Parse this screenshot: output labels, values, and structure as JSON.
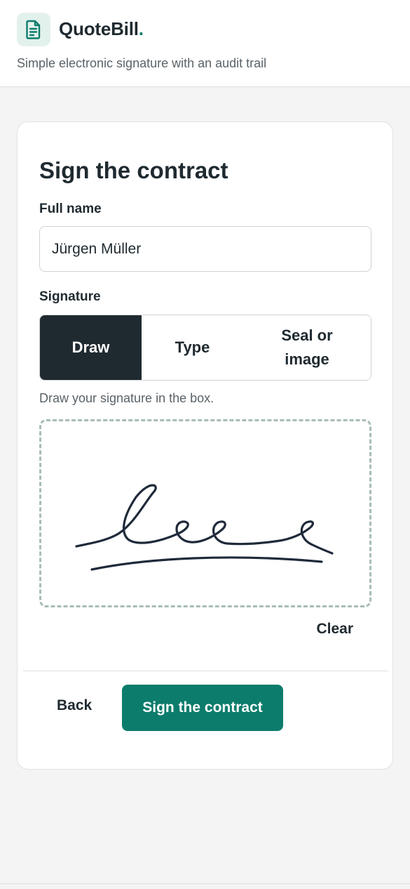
{
  "header": {
    "brand_name": "QuoteBill",
    "brand_dot": ".",
    "tagline": "Simple electronic signature with an audit trail",
    "logo_icon": "document-icon"
  },
  "form": {
    "title": "Sign the contract",
    "full_name_label": "Full name",
    "full_name_value": "Jürgen Müller",
    "signature_label": "Signature",
    "tabs": [
      {
        "label": "Draw",
        "active": true
      },
      {
        "label": "Type",
        "active": false
      },
      {
        "label": "Seal or image",
        "active": false
      }
    ],
    "hint": "Draw your signature in the box.",
    "clear_label": "Clear",
    "back_label": "Back",
    "submit_label": "Sign the contract"
  },
  "colors": {
    "accent": "#0c7c6c",
    "dark": "#1f2a30",
    "logo_bg": "#e3f1ec",
    "dashed_border": "#a8bdb6"
  }
}
